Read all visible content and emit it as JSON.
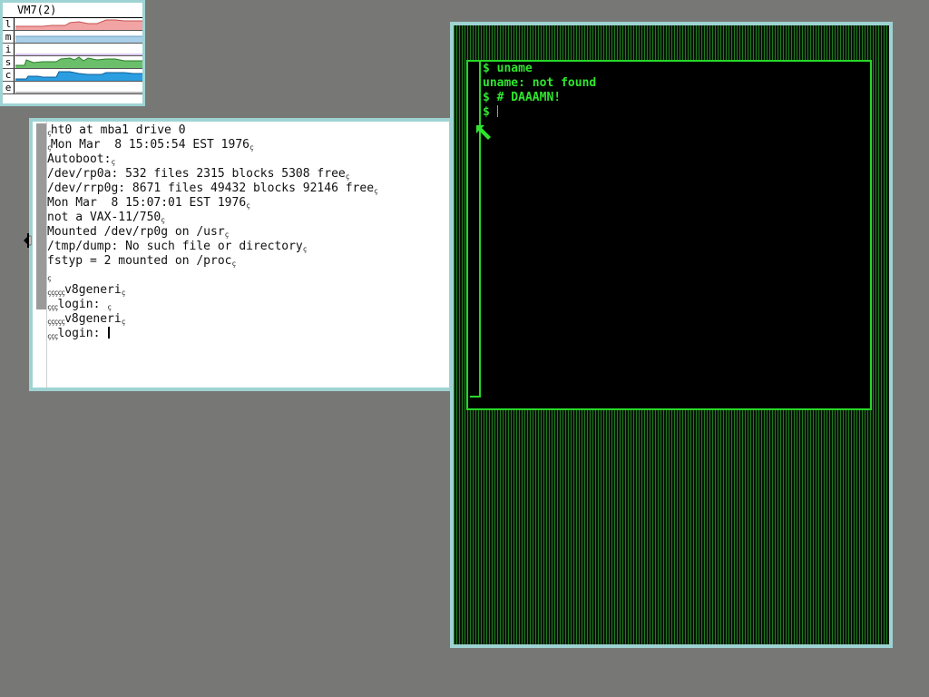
{
  "vismon": {
    "title": "VM7(2)",
    "rows": [
      {
        "label": "l",
        "color": "#f2a3a3"
      },
      {
        "label": "m",
        "color": "#a9cfe9"
      },
      {
        "label": "i",
        "color": "#d9c9ef"
      },
      {
        "label": "s",
        "color": "#6bbf6b"
      },
      {
        "label": "c",
        "color": "#2a9ee0"
      },
      {
        "label": "e",
        "color": "#b9b9b9"
      }
    ]
  },
  "white_terminal": {
    "lines": [
      {
        "text": "ht0 at mba1 drive 0",
        "pre": "ç",
        "post": ""
      },
      {
        "text": "Mon Mar  8 15:05:54 EST 1976",
        "pre": "ç",
        "post": "ç"
      },
      {
        "text": "Autoboot:",
        "pre": "",
        "post": "ç"
      },
      {
        "text": "/dev/rp0a: 532 files 2315 blocks 5308 free",
        "pre": "",
        "post": "ç"
      },
      {
        "text": "/dev/rrp0g: 8671 files 49432 blocks 92146 free",
        "pre": "",
        "post": "ç"
      },
      {
        "text": "Mon Mar  8 15:07:01 EST 1976",
        "pre": "",
        "post": "ç"
      },
      {
        "text": "not a VAX-11/750",
        "pre": "",
        "post": "ç"
      },
      {
        "text": "Mounted /dev/rp0g on /usr",
        "pre": "",
        "post": "ç"
      },
      {
        "text": "/tmp/dump: No such file or directory",
        "pre": "",
        "post": "ç"
      },
      {
        "text": "fstyp = 2 mounted on /proc",
        "pre": "",
        "post": "ç"
      },
      {
        "text": "",
        "pre": "ç",
        "post": ""
      },
      {
        "text": "v8generi",
        "pre": "ççççç",
        "post": "ç"
      },
      {
        "text": "login: ",
        "pre": "ççç",
        "post": "ç"
      },
      {
        "text": "v8generi",
        "pre": "ççççç",
        "post": "ç"
      },
      {
        "text": "login: ",
        "pre": "ççç",
        "post": ""
      }
    ]
  },
  "green_terminal": {
    "lines": [
      "$ uname",
      "uname: not found",
      "$ # DAAAMN!",
      "$ "
    ]
  }
}
